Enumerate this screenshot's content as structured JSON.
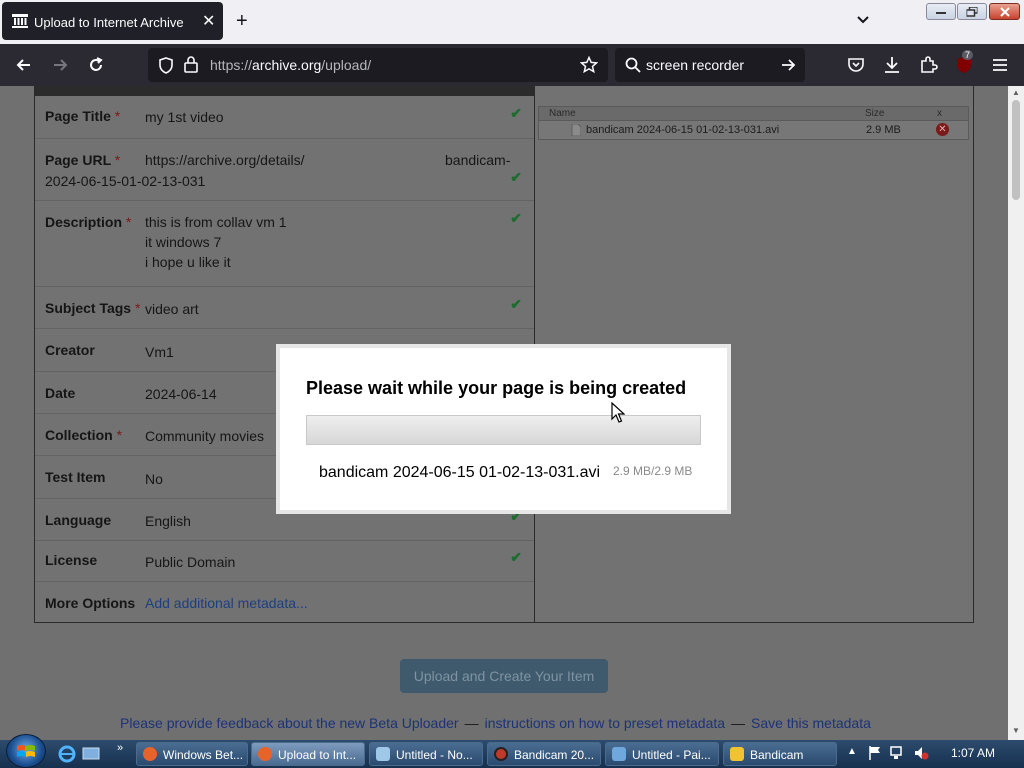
{
  "browser": {
    "tab_title": "Upload to Internet Archive",
    "url_prefix": "https://",
    "url_domain": "archive.org",
    "url_path": "/upload/",
    "search_text": "screen recorder",
    "extension_badge": "7"
  },
  "form": {
    "rows": [
      {
        "label": "Page Title",
        "required": "*",
        "value": "my 1st video"
      },
      {
        "label": "Page URL",
        "required": "*",
        "value_left": "https://archive.org/details/",
        "value_right": "bandicam-",
        "value_line2": "2024-06-15-01-02-13-031"
      },
      {
        "label": "Description",
        "required": "*",
        "lines": [
          "this is from collav vm 1",
          "it windows 7",
          "i hope u like it"
        ]
      },
      {
        "label": "Subject Tags",
        "required": "*",
        "value": "video art"
      },
      {
        "label": "Creator",
        "value": "Vm1"
      },
      {
        "label": "Date",
        "value": "2024-06-14"
      },
      {
        "label": "Collection",
        "required": "*",
        "value": "Community movies"
      },
      {
        "label": "Test Item",
        "value": "No"
      },
      {
        "label": "Language",
        "value": "English"
      },
      {
        "label": "License",
        "value": "Public Domain"
      },
      {
        "label": "More Options",
        "value": "Add additional metadata..."
      }
    ]
  },
  "files": {
    "headers": {
      "name": "Name",
      "size": "Size",
      "remove": "x"
    },
    "rows": [
      {
        "name": "bandicam 2024-06-15 01-02-13-031.avi",
        "size": "2.9 MB"
      }
    ]
  },
  "upload_button": "Upload and Create Your Item",
  "footer": {
    "feedback": "Please provide feedback about the new Beta Uploader",
    "sep": "—",
    "instructions": "instructions on how to preset metadata",
    "save": "Save this metadata"
  },
  "modal": {
    "title": "Please wait while your page is being created",
    "progress_fraction": 1.0,
    "file_name": "bandicam 2024-06-15 01-02-13-031.avi",
    "file_size": "2.9 MB/2.9 MB"
  },
  "taskbar": {
    "items": [
      {
        "label": "Windows Bet...",
        "icon_color": "#e8632a"
      },
      {
        "label": "Upload to Int...",
        "icon_color": "#e8632a",
        "active": true
      },
      {
        "label": "Untitled - No...",
        "icon_color": "#9ec7e8"
      },
      {
        "label": "Bandicam 20...",
        "icon_color": "#c0392b"
      },
      {
        "label": "Untitled - Pai...",
        "icon_color": "#6fa8dc"
      },
      {
        "label": "Bandicam",
        "icon_color": "#f1c232"
      }
    ],
    "clock": "1:07 AM"
  }
}
